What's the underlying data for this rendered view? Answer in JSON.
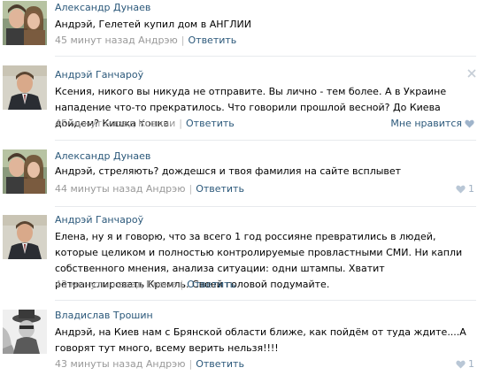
{
  "comments": [
    {
      "author": "Александр Дунаев",
      "text": "Андрэй, Гелетей купил дом в АНГЛИИ",
      "time": "45 минут назад Андрэю",
      "reply": "Ответить",
      "like_text": "",
      "avatar": "couple-photo"
    },
    {
      "author": "Андрэй Ганчароў",
      "text": "Ксения, никого вы никуда не отправите. Вы лично - тем более. А в Украине нападение что-то прекратилось. Что говорили прошлой весной? До Киева дойдем? Кишка тонка.",
      "time": "45 минут назад Ксении",
      "reply": "Ответить",
      "like_text": "Мне нравится",
      "avatar": "man-in-suit-photo"
    },
    {
      "author": "Александр Дунаев",
      "text": "Андрэй, стреляють? дождешся и твоя фамилия на сайте всплывет",
      "time": "44 минуты назад Андрэю",
      "reply": "Ответить",
      "like_text": "1",
      "avatar": "couple-photo"
    },
    {
      "author": "Андрэй Ганчароў",
      "text": "Елена, ну я и говорю, что за всего 1 год россияне превратились в людей, которые целиком и полностью контролируемые провластными СМИ. Ни капли собственного мнения, анализа ситуации: одни штампы. Хватит ретранслировать Кремль. Своей головой подумайте.",
      "time": "43 минуты назад Елене",
      "reply": "Ответить",
      "like_text": "",
      "avatar": "man-in-suit-photo"
    },
    {
      "author": "Владислав Трошин",
      "text": "Андрэй, на Киев нам с Брянской области ближе, как пойдём от туда ждите....А говорят тут много, всему верить нельзя!!!!",
      "time": "43 минуты назад Андрэю",
      "reply": "Ответить",
      "like_text": "1",
      "avatar": "hat-man-photo"
    }
  ],
  "colors": {
    "link": "#2b587a",
    "meta": "#999999",
    "divider": "#e7eaed"
  }
}
